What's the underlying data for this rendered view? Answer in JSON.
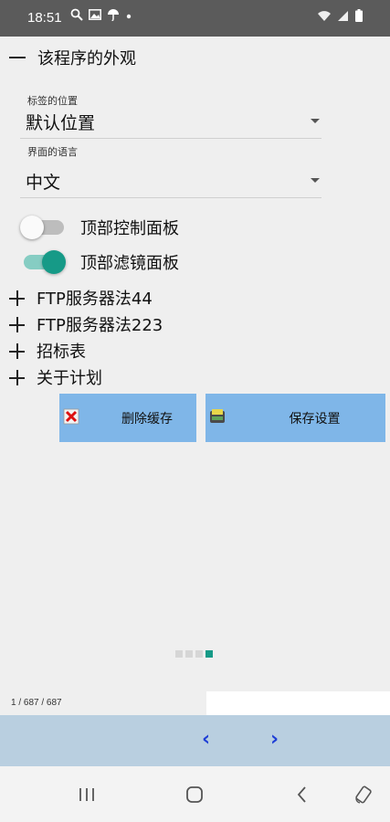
{
  "status_bar": {
    "time": "18:51",
    "left_icons": [
      "search-icon",
      "image-icon",
      "umbrella-icon",
      "dot-icon"
    ],
    "right_icons": [
      "wifi-icon",
      "signal-icon",
      "battery-icon"
    ]
  },
  "settings": {
    "section_title": "该程序的外观",
    "tab_position": {
      "label": "标签的位置",
      "value": "默认位置"
    },
    "language": {
      "label": "界面的语言",
      "value": "中文"
    },
    "toggles": [
      {
        "label": "顶部控制面板",
        "checked": false
      },
      {
        "label": "顶部滤镜面板",
        "checked": true
      }
    ],
    "expand_items": [
      {
        "label": "FTP服务器法44"
      },
      {
        "label": "FTP服务器法223"
      },
      {
        "label": "招标表"
      },
      {
        "label": "关于计划"
      }
    ],
    "buttons": {
      "clear_cache": "删除缓存",
      "save_settings": "保存设置"
    }
  },
  "pager": {
    "counter": "1 / 687 / 687",
    "dots": 4,
    "active_dot": 4,
    "prev": "‹",
    "next": "›"
  },
  "colors": {
    "accent": "#169a87",
    "button_bg": "#7fb6e8",
    "nav_panel_bg": "#b9cfe0",
    "arrow_color": "#1f3fd6",
    "status_bar_bg": "#5b5b5b"
  }
}
